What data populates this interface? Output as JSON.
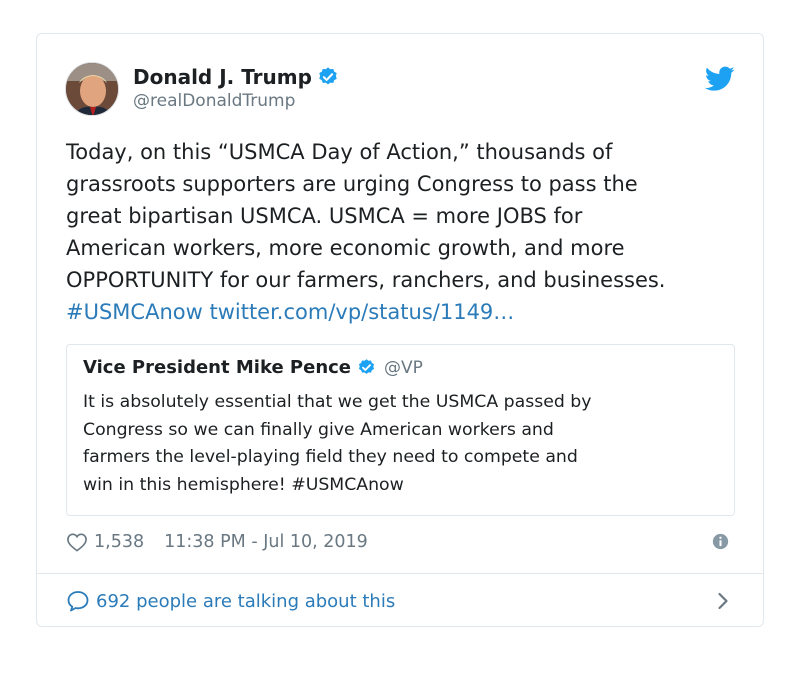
{
  "author": {
    "display_name": "Donald J. Trump",
    "handle": "@realDonaldTrump",
    "verified": true
  },
  "tweet": {
    "text_lines": [
      "Today, on this “USMCA Day of Action,” thousands of",
      "grassroots supporters are urging Congress to pass the",
      "great bipartisan USMCA. USMCA = more JOBS for",
      "American workers, more economic growth, and more",
      "OPPORTUNITY for our farmers, ranchers, and businesses."
    ],
    "hashtag": "#USMCAnow",
    "link": "twitter.com/vp/status/1149…"
  },
  "quoted": {
    "display_name": "Vice President Mike Pence",
    "handle": "@VP",
    "text_lines": [
      "It is absolutely essential that we get the USMCA passed by",
      "Congress so we can finally give American workers and",
      "farmers the level-playing field they need to compete and",
      "win in this hemisphere! #USMCAnow"
    ]
  },
  "meta": {
    "likes": "1,538",
    "timestamp": "11:38 PM - Jul 10, 2019"
  },
  "footer": {
    "conversation_label": "692 people are talking about this"
  },
  "colors": {
    "link": "#2b7bb9",
    "verified": "#1da1f2",
    "twitter_brand": "#1da1f2",
    "muted": "#697882",
    "border": "#e1e8ed"
  },
  "icons": [
    "verified-badge-icon",
    "twitter-bird-icon",
    "heart-icon",
    "info-icon",
    "speech-bubble-icon",
    "chevron-right-icon"
  ]
}
